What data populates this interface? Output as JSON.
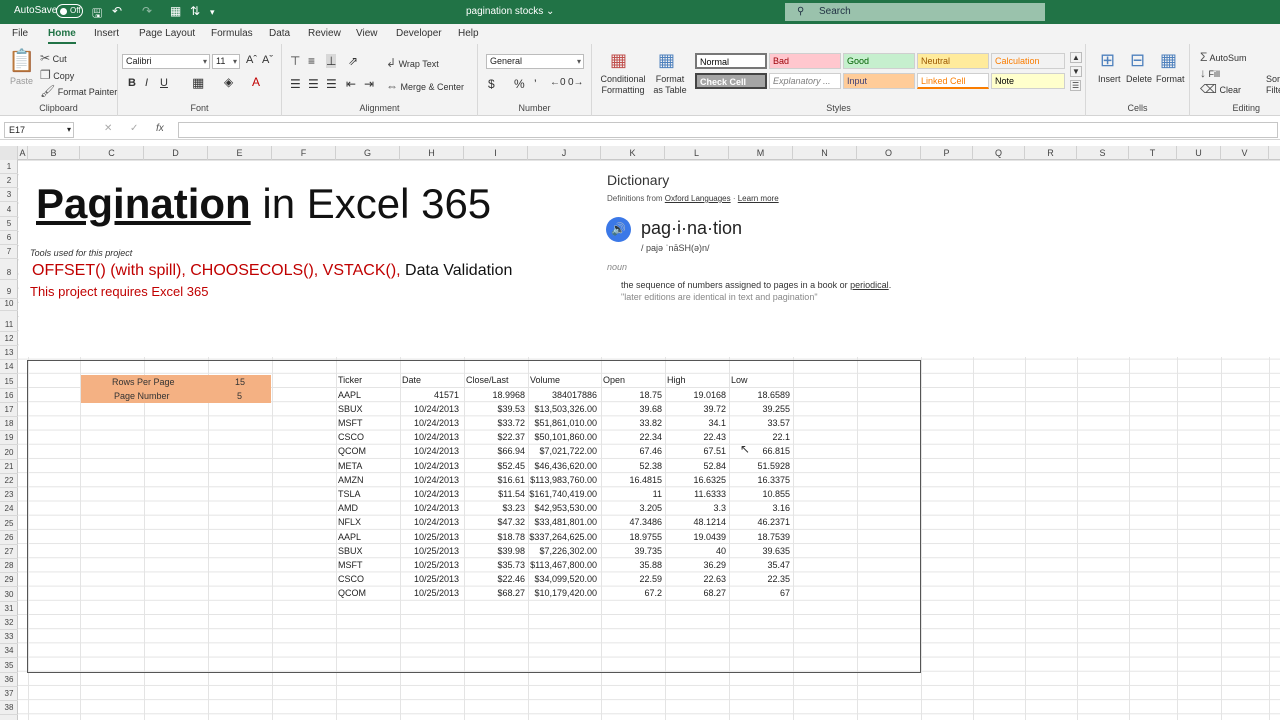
{
  "titlebar": {
    "autosave_label": "AutoSave",
    "autosave_state": "Off",
    "document_name": "pagination stocks ⌄",
    "search_placeholder": "Search"
  },
  "tabs": [
    "File",
    "Home",
    "Insert",
    "Page Layout",
    "Formulas",
    "Data",
    "Review",
    "View",
    "Developer",
    "Help"
  ],
  "ribbon": {
    "clipboard": {
      "paste": "Paste",
      "cut": "Cut",
      "copy": "Copy",
      "format_painter": "Format Painter",
      "label": "Clipboard"
    },
    "font": {
      "name": "Calibri",
      "size": "11",
      "label": "Font"
    },
    "alignment": {
      "wrap_text": "Wrap Text",
      "merge_center": "Merge & Center",
      "label": "Alignment"
    },
    "number": {
      "format": "General",
      "label": "Number"
    },
    "styles": {
      "conditional_formatting": "Conditional Formatting",
      "format_as_table": "Format as Table",
      "label": "Styles",
      "cells": [
        {
          "name": "Normal",
          "bg": "#ffffff",
          "fg": "#000000"
        },
        {
          "name": "Bad",
          "bg": "#ffc7ce",
          "fg": "#9c0006"
        },
        {
          "name": "Good",
          "bg": "#c6efce",
          "fg": "#006100"
        },
        {
          "name": "Neutral",
          "bg": "#ffeb9c",
          "fg": "#9c5700"
        },
        {
          "name": "Calculation",
          "bg": "#f2f2f2",
          "fg": "#fa7d00"
        },
        {
          "name": "Check Cell",
          "bg": "#a5a5a5",
          "fg": "#ffffff"
        },
        {
          "name": "Explanatory ...",
          "bg": "#ffffff",
          "fg": "#7f7f7f"
        },
        {
          "name": "Input",
          "bg": "#ffcc99",
          "fg": "#3f3f76"
        },
        {
          "name": "Linked Cell",
          "bg": "#ffffff",
          "fg": "#fa7d00"
        },
        {
          "name": "Note",
          "bg": "#ffffcc",
          "fg": "#000000"
        }
      ]
    },
    "cells": {
      "insert": "Insert",
      "delete": "Delete",
      "format": "Format",
      "label": "Cells"
    },
    "editing": {
      "autosum": "AutoSum",
      "fill": "Fill",
      "clear": "Clear",
      "sort": "Sort",
      "filter": "Filte",
      "label": "Editing"
    }
  },
  "formula_bar": {
    "name_box": "E17",
    "formula": ""
  },
  "columns": [
    "A",
    "B",
    "C",
    "D",
    "E",
    "F",
    "G",
    "H",
    "I",
    "J",
    "K",
    "L",
    "M",
    "N",
    "O",
    "P",
    "Q",
    "R",
    "S",
    "T",
    "U",
    "V"
  ],
  "rows": [
    "1",
    "2",
    "3",
    "4",
    "5",
    "6",
    "7",
    "8",
    "9",
    "10",
    "11",
    "12",
    "13",
    "14",
    "15",
    "16",
    "17",
    "18",
    "19",
    "20",
    "21",
    "22",
    "23",
    "24",
    "25",
    "26",
    "27",
    "28",
    "29",
    "30",
    "31",
    "32",
    "33",
    "34",
    "35",
    "36",
    "37",
    "38"
  ],
  "sheet": {
    "title_underlined": "Pagination",
    "title_rest": " in Excel 365",
    "tools_label": "Tools used for this project",
    "tools_red": "OFFSET() (with spill), CHOOSECOLS(), VSTACK(),",
    "tools_black": " Data Validation",
    "requires": "This project requires Excel 365"
  },
  "dictionary": {
    "heading": "Dictionary",
    "source_prefix": "Definitions from ",
    "source_link": "Oxford Languages",
    "source_sep": " · ",
    "learn_more": "Learn more",
    "word": "pag·i·na·tion",
    "phonetic": "/ pajə ˈnāSH(ə)n/",
    "pos": "noun",
    "definition": "the sequence of numbers assigned to pages in a book or ",
    "definition_link": "periodical",
    "definition_end": ".",
    "example": "\"later editions are identical in text and pagination\""
  },
  "params": {
    "rows_per_page_label": "Rows Per Page",
    "rows_per_page": "15",
    "page_number_label": "Page Number",
    "page_number": "5"
  },
  "table": {
    "headers": [
      "Ticker",
      "Date",
      "Close/Last",
      "Volume",
      "Open",
      "High",
      "Low"
    ],
    "rows": [
      [
        "AAPL",
        "41571",
        "18.9968",
        "384017886",
        "18.75",
        "19.0168",
        "18.6589"
      ],
      [
        "SBUX",
        "10/24/2013",
        "$39.53",
        "$13,503,326.00",
        "39.68",
        "39.72",
        "39.255"
      ],
      [
        "MSFT",
        "10/24/2013",
        "$33.72",
        "$51,861,010.00",
        "33.82",
        "34.1",
        "33.57"
      ],
      [
        "CSCO",
        "10/24/2013",
        "$22.37",
        "$50,101,860.00",
        "22.34",
        "22.43",
        "22.1"
      ],
      [
        "QCOM",
        "10/24/2013",
        "$66.94",
        "$7,021,722.00",
        "67.46",
        "67.51",
        "66.815"
      ],
      [
        "META",
        "10/24/2013",
        "$52.45",
        "$46,436,620.00",
        "52.38",
        "52.84",
        "51.5928"
      ],
      [
        "AMZN",
        "10/24/2013",
        "$16.61",
        "$113,983,760.00",
        "16.4815",
        "16.6325",
        "16.3375"
      ],
      [
        "TSLA",
        "10/24/2013",
        "$11.54",
        "$161,740,419.00",
        "11",
        "11.6333",
        "10.855"
      ],
      [
        "AMD",
        "10/24/2013",
        "$3.23",
        "$42,953,530.00",
        "3.205",
        "3.3",
        "3.16"
      ],
      [
        "NFLX",
        "10/24/2013",
        "$47.32",
        "$33,481,801.00",
        "47.3486",
        "48.1214",
        "46.2371"
      ],
      [
        "AAPL",
        "10/25/2013",
        "$18.78",
        "$337,264,625.00",
        "18.9755",
        "19.0439",
        "18.7539"
      ],
      [
        "SBUX",
        "10/25/2013",
        "$39.98",
        "$7,226,302.00",
        "39.735",
        "40",
        "39.635"
      ],
      [
        "MSFT",
        "10/25/2013",
        "$35.73",
        "$113,467,800.00",
        "35.88",
        "36.29",
        "35.47"
      ],
      [
        "CSCO",
        "10/25/2013",
        "$22.46",
        "$34,099,520.00",
        "22.59",
        "22.63",
        "22.35"
      ],
      [
        "QCOM",
        "10/25/2013",
        "$68.27",
        "$10,179,420.00",
        "67.2",
        "68.27",
        "67"
      ]
    ]
  },
  "colors": {
    "accent": "#217346",
    "red_text": "#c00000",
    "param_fill": "#f4b183"
  }
}
